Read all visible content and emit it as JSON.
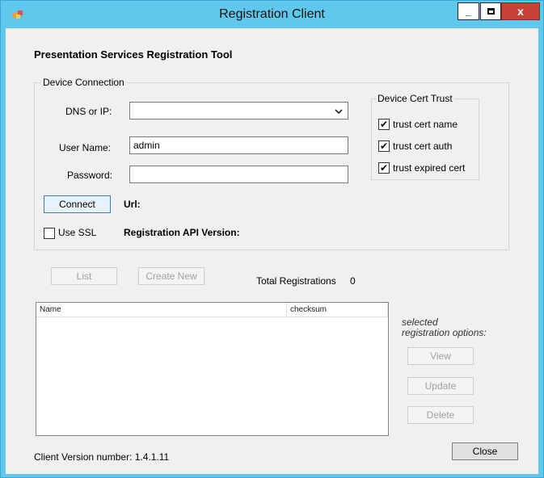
{
  "window": {
    "title": "Registration Client",
    "min_glyph": "_",
    "max_glyph": "□",
    "close_glyph": "x"
  },
  "heading": "Presentation Services Registration Tool",
  "device_connection": {
    "legend": "Device Connection",
    "dns_label": "DNS or IP:",
    "dns_value": "",
    "user_label": "User Name:",
    "user_value": "admin",
    "password_label": "Password:",
    "password_value": "",
    "connect_label": "Connect",
    "url_label": "Url:",
    "use_ssl_label": "Use SSL",
    "use_ssl_checked": false,
    "api_version_label": "Registration API Version:"
  },
  "cert_trust": {
    "legend": "Device Cert Trust",
    "items": [
      {
        "label": "trust cert name",
        "checked": true
      },
      {
        "label": "trust cert auth",
        "checked": true
      },
      {
        "label": "trust expired cert",
        "checked": true
      }
    ]
  },
  "actions": {
    "list_label": "List",
    "create_label": "Create New",
    "total_label": "Total Registrations",
    "total_value": "0"
  },
  "listview": {
    "columns": [
      "Name",
      "checksum"
    ]
  },
  "options": {
    "caption_line1": "selected",
    "caption_line2": "registration options:",
    "view_label": "View",
    "update_label": "Update",
    "delete_label": "Delete"
  },
  "footer": {
    "version_label": "Client Version number: 1.4.1.11",
    "close_label": "Close"
  },
  "colors": {
    "titlebar": "#5fc8ec",
    "client": "#f0f0f0",
    "close_button": "#c7433a"
  }
}
